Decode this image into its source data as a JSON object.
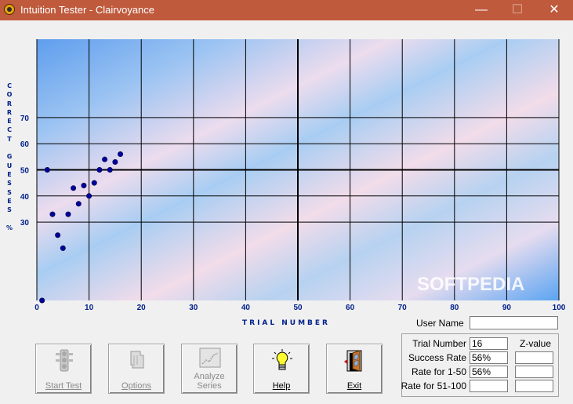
{
  "window": {
    "title": "Intuition Tester - Clairvoyance",
    "minimize_glyph": "—",
    "maximize_glyph": "☐",
    "close_glyph": "✕"
  },
  "chart_data": {
    "type": "scatter",
    "y_axis_label": "CORRECT GUESSES %",
    "x_axis_label": "TRIAL NUMBER",
    "x_ticks": [
      0,
      10,
      20,
      30,
      40,
      50,
      60,
      70,
      80,
      90,
      100
    ],
    "y_ticks": [
      30,
      40,
      50,
      60,
      70
    ],
    "xlim": [
      0,
      100
    ],
    "ylim": [
      0,
      100
    ],
    "grid": true,
    "bold_reference_lines": {
      "x": 50,
      "y": 50
    },
    "point_color": "#0000a0",
    "x": [
      1,
      2,
      3,
      4,
      5,
      6,
      7,
      8,
      9,
      10,
      11,
      12,
      13,
      14,
      15,
      16
    ],
    "y": [
      0,
      50,
      33,
      25,
      20,
      33,
      43,
      37,
      44,
      40,
      45,
      50,
      54,
      50,
      53,
      56
    ]
  },
  "watermark": "SOFTPEDIA",
  "buttons": [
    {
      "name": "start-test-button",
      "label": "Start Test",
      "icon": "traffic-light-icon",
      "enabled": false
    },
    {
      "name": "options-button",
      "label": "Options",
      "icon": "options-icon",
      "enabled": false
    },
    {
      "name": "analyze-series-button",
      "label": "Analyze Series",
      "label_line1": "Analyze",
      "label_line2": "Series",
      "icon": "graph-icon",
      "enabled": false
    },
    {
      "name": "help-button",
      "label": "Help",
      "icon": "lightbulb-icon",
      "enabled": true
    },
    {
      "name": "exit-button",
      "label": "Exit",
      "icon": "door-exit-icon",
      "enabled": true
    }
  ],
  "user_name": {
    "label": "User Name",
    "value": ""
  },
  "stats": {
    "trial_number": {
      "label": "Trial Number",
      "value": "16"
    },
    "zvalue_header": "Z-value",
    "success_rate": {
      "label": "Success Rate",
      "value": "56%",
      "z": ""
    },
    "rate_1_50": {
      "label": "Rate for 1-50",
      "value": "56%",
      "z": ""
    },
    "rate_51_100": {
      "label": "Rate for 51-100",
      "value": "",
      "z": ""
    }
  }
}
